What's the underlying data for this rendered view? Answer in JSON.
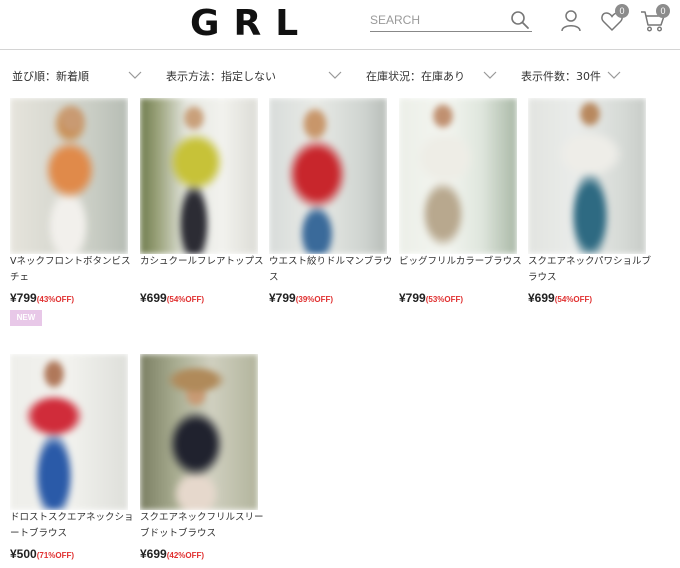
{
  "header": {
    "logo": "GRL",
    "search_placeholder": "SEARCH",
    "favorites_count": "0",
    "cart_count": "0"
  },
  "filters": [
    {
      "label": "並び順：新着順"
    },
    {
      "label": "表示方法：指定しない"
    },
    {
      "label": "在庫状況：在庫あり"
    },
    {
      "label": "表示件数：30件"
    }
  ],
  "products": [
    {
      "name": "Vネックフロントボタンビスチェ",
      "price": "¥799",
      "discount": "(43%OFF)",
      "badge": "NEW"
    },
    {
      "name": "カシュクールフレアトップス",
      "price": "¥699",
      "discount": "(54%OFF)"
    },
    {
      "name": "ウエスト絞りドルマンブラウス",
      "price": "¥799",
      "discount": "(39%OFF)"
    },
    {
      "name": "ビッグフリルカラーブラウス",
      "price": "¥799",
      "discount": "(53%OFF)"
    },
    {
      "name": "スクエアネックパワショルブラウス",
      "price": "¥699",
      "discount": "(54%OFF)"
    },
    {
      "name": "ドロストスクエアネックショートブラウス",
      "price": "¥500",
      "discount": "(71%OFF)"
    },
    {
      "name": "スクエアネックフリルスリーブドットブラウス",
      "price": "¥699",
      "discount": "(42%OFF)"
    }
  ],
  "colors": {
    "discount": "#e03030",
    "new_badge": "#e8c8e8",
    "count_badge": "#8c8c8c"
  }
}
